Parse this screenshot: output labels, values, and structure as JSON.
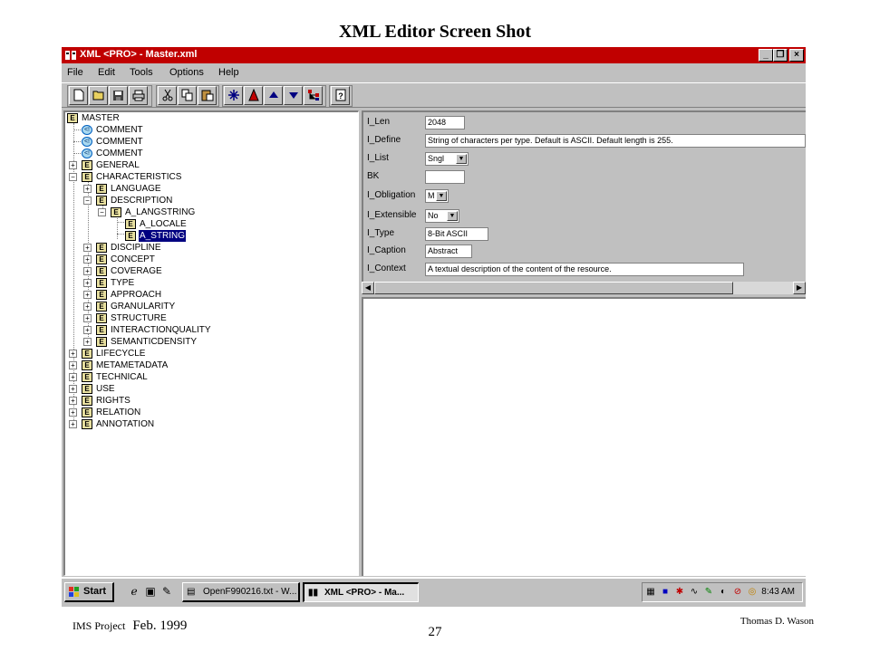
{
  "slide": {
    "title": "XML Editor Screen Shot",
    "footer_left": "IMS Project",
    "footer_date": "Feb. 1999",
    "page_number": "27",
    "footer_right": "Thomas D. Wason"
  },
  "window": {
    "title": "XML <PRO> - Master.xml",
    "controls": {
      "minimize": "_",
      "maximize": "❐",
      "close": "×"
    }
  },
  "menu": [
    "File",
    "Edit",
    "Tools",
    "Options",
    "Help"
  ],
  "toolbar": {
    "buttons": [
      "new-file-icon",
      "open-folder-icon",
      "save-icon",
      "print-icon",
      "cut-icon",
      "copy-icon",
      "paste-icon",
      "add-element-icon",
      "add-attribute-icon",
      "move-up-icon",
      "move-down-icon",
      "tree-icon",
      "help-icon"
    ]
  },
  "tree": {
    "root": "MASTER",
    "comments": [
      "COMMENT",
      "COMMENT",
      "COMMENT"
    ],
    "general": "GENERAL",
    "characteristics": "CHARACTERISTICS",
    "language": "LANGUAGE",
    "description": "DESCRIPTION",
    "a_langstring": "A_LANGSTRING",
    "a_locale": "A_LOCALE",
    "a_string": "A_STRING",
    "char_children": [
      "DISCIPLINE",
      "CONCEPT",
      "COVERAGE",
      "TYPE",
      "APPROACH",
      "GRANULARITY",
      "STRUCTURE",
      "INTERACTIONQUALITY",
      "SEMANTICDENSITY"
    ],
    "top_children": [
      "LIFECYCLE",
      "METAMETADATA",
      "TECHNICAL",
      "USE",
      "RIGHTS",
      "RELATION",
      "ANNOTATION"
    ]
  },
  "attributes": {
    "len": {
      "label": "I_Len",
      "value": "2048"
    },
    "define": {
      "label": "I_Define",
      "value": "String of characters per type.  Default is ASCII. Default length is 255."
    },
    "list": {
      "label": "I_List",
      "value": "Sngl"
    },
    "bk": {
      "label": "BK",
      "value": ""
    },
    "obligation": {
      "label": "I_Obligation",
      "value": "M"
    },
    "extensible": {
      "label": "I_Extensible",
      "value": "No"
    },
    "type": {
      "label": "I_Type",
      "value": "8-Bit ASCII"
    },
    "caption": {
      "label": "I_Caption",
      "value": "Abstract"
    },
    "context": {
      "label": "I_Context",
      "value": "A textual description of the content of the resource."
    }
  },
  "taskbar": {
    "start_label": "Start",
    "tasks": [
      {
        "label": "OpenF990216.txt - W...",
        "icon": "notepad-icon"
      },
      {
        "label": "XML <PRO> - Ma...",
        "icon": "xmlpro-icon"
      }
    ],
    "clock": "8:43 AM"
  },
  "colors": {
    "titlebar": "#c00000",
    "selection": "#000080",
    "chrome": "#c0c0c0"
  }
}
